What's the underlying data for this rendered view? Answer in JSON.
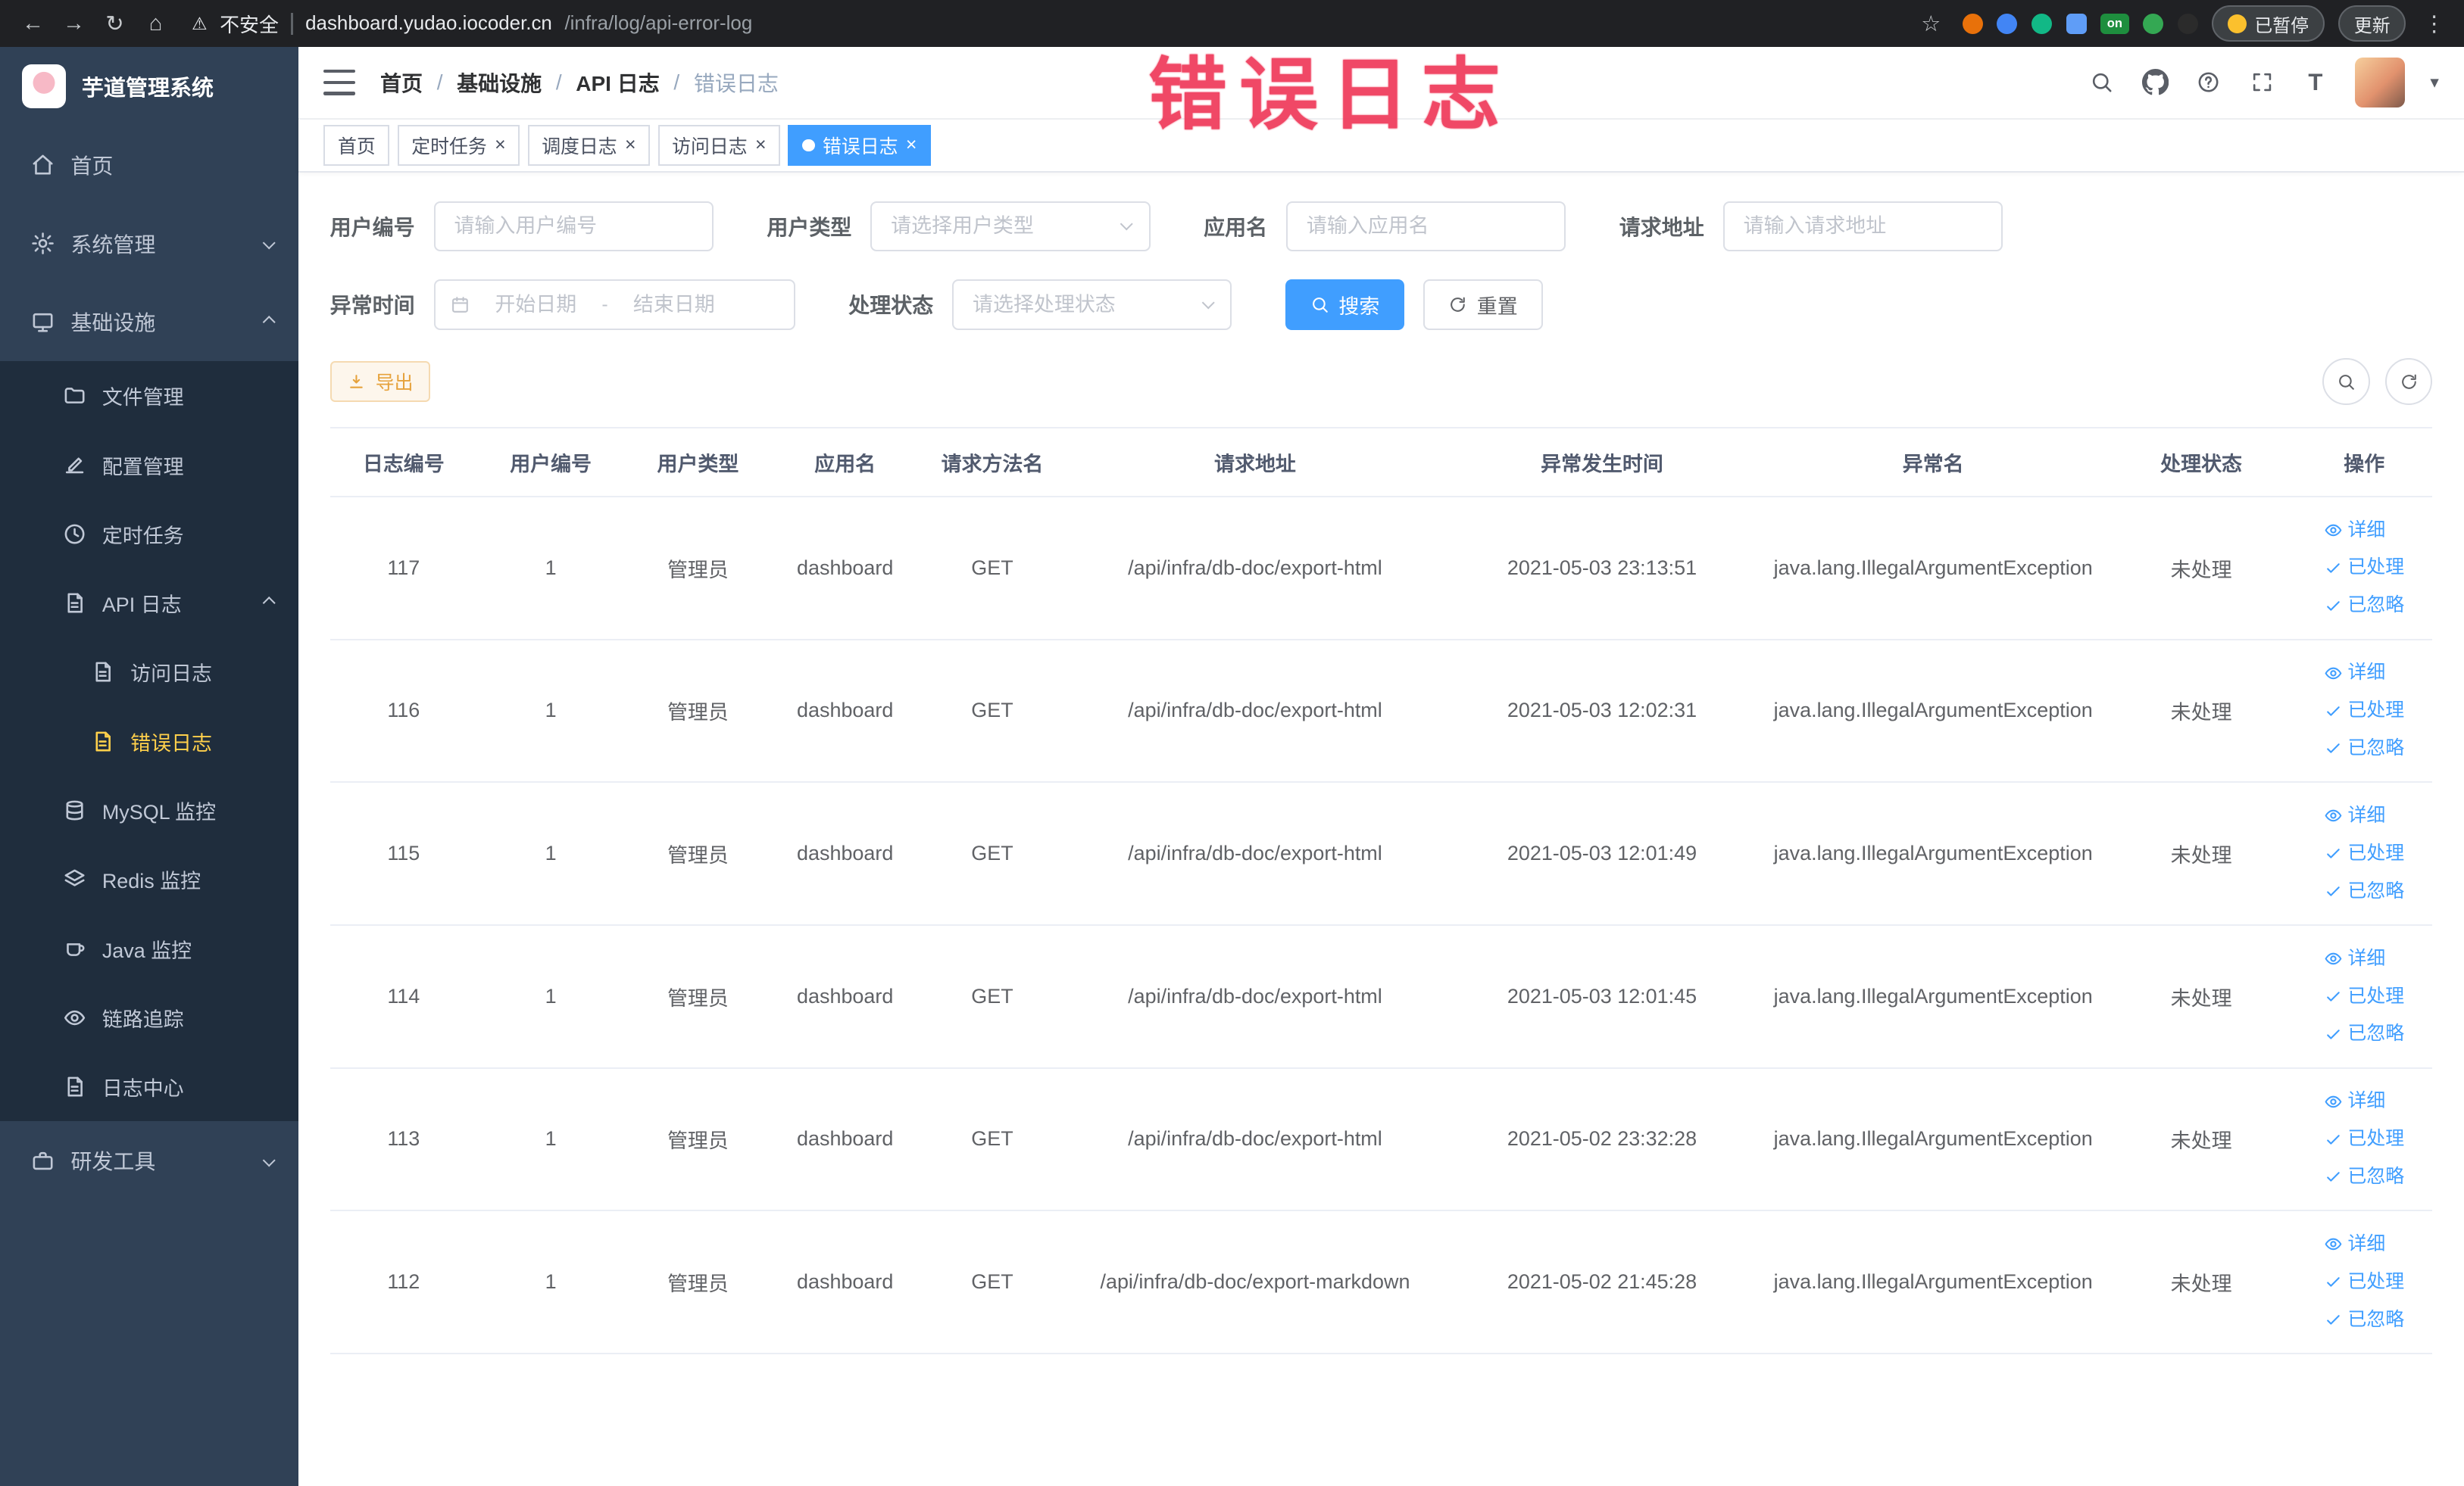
{
  "colors": {
    "accent": "#409eff",
    "sidebar_bg": "#304156",
    "submenu_bg": "#1f2d3d",
    "active_menu_text": "#ffd04b",
    "warning": "#e6a23c",
    "annotation_red": "#ef3b5b"
  },
  "icons": {
    "back": "←",
    "forward": "→",
    "reload": "↻",
    "home": "⌂",
    "warning": "⚠",
    "star": "☆",
    "kebab": "⋮",
    "close": "×",
    "caret": "▾",
    "font_size": "T"
  },
  "browser": {
    "security_label": "不安全",
    "url_domain": "dashboard.yudao.iocoder.cn",
    "url_path": "/infra/log/api-error-log",
    "ext_on_badge": "on",
    "paused_badge": "已暂停",
    "update_button": "更新"
  },
  "annotation": {
    "text": "错误日志"
  },
  "sidebar": {
    "logo_title": "芋道管理系统",
    "home": "首页",
    "system": "系统管理",
    "infra": "基础设施",
    "file": "文件管理",
    "config": "配置管理",
    "job": "定时任务",
    "api_log": "API 日志",
    "access_log": "访问日志",
    "error_log": "错误日志",
    "mysql": "MySQL 监控",
    "redis": "Redis 监控",
    "java": "Java 监控",
    "trace": "链路追踪",
    "log_center": "日志中心",
    "dev_tools": "研发工具"
  },
  "breadcrumb": {
    "separator": "/",
    "items": [
      "首页",
      "基础设施",
      "API 日志",
      "错误日志"
    ]
  },
  "tabs": {
    "items": [
      {
        "label": "首页"
      },
      {
        "label": "定时任务"
      },
      {
        "label": "调度日志"
      },
      {
        "label": "访问日志"
      },
      {
        "label": "错误日志"
      }
    ]
  },
  "filters": {
    "user_id_label": "用户编号",
    "user_id_placeholder": "请输入用户编号",
    "user_type_label": "用户类型",
    "user_type_placeholder": "请选择用户类型",
    "app_name_label": "应用名",
    "app_name_placeholder": "请输入应用名",
    "request_url_label": "请求地址",
    "request_url_placeholder": "请输入请求地址",
    "exception_time_label": "异常时间",
    "date_start_placeholder": "开始日期",
    "date_separator": "-",
    "date_end_placeholder": "结束日期",
    "process_status_label": "处理状态",
    "process_status_placeholder": "请选择处理状态",
    "search_button": "搜索",
    "reset_button": "重置"
  },
  "toolbar": {
    "export_button": "导出"
  },
  "table": {
    "columns": [
      "日志编号",
      "用户编号",
      "用户类型",
      "应用名",
      "请求方法名",
      "请求地址",
      "异常发生时间",
      "异常名",
      "处理状态",
      "操作"
    ],
    "actions": {
      "detail": "详细",
      "process": "已处理",
      "ignore": "已忽略"
    },
    "rows": [
      {
        "id": "117",
        "user_id": "1",
        "user_type": "管理员",
        "app": "dashboard",
        "method": "GET",
        "url": "/api/infra/db-doc/export-html",
        "time": "2021-05-03 23:13:51",
        "exception": "java.lang.IllegalArgumentException",
        "status": "未处理"
      },
      {
        "id": "116",
        "user_id": "1",
        "user_type": "管理员",
        "app": "dashboard",
        "method": "GET",
        "url": "/api/infra/db-doc/export-html",
        "time": "2021-05-03 12:02:31",
        "exception": "java.lang.IllegalArgumentException",
        "status": "未处理"
      },
      {
        "id": "115",
        "user_id": "1",
        "user_type": "管理员",
        "app": "dashboard",
        "method": "GET",
        "url": "/api/infra/db-doc/export-html",
        "time": "2021-05-03 12:01:49",
        "exception": "java.lang.IllegalArgumentException",
        "status": "未处理"
      },
      {
        "id": "114",
        "user_id": "1",
        "user_type": "管理员",
        "app": "dashboard",
        "method": "GET",
        "url": "/api/infra/db-doc/export-html",
        "time": "2021-05-03 12:01:45",
        "exception": "java.lang.IllegalArgumentException",
        "status": "未处理"
      },
      {
        "id": "113",
        "user_id": "1",
        "user_type": "管理员",
        "app": "dashboard",
        "method": "GET",
        "url": "/api/infra/db-doc/export-html",
        "time": "2021-05-02 23:32:28",
        "exception": "java.lang.IllegalArgumentException",
        "status": "未处理"
      },
      {
        "id": "112",
        "user_id": "1",
        "user_type": "管理员",
        "app": "dashboard",
        "method": "GET",
        "url": "/api/infra/db-doc/export-markdown",
        "time": "2021-05-02 21:45:28",
        "exception": "java.lang.IllegalArgumentException",
        "status": "未处理"
      }
    ]
  }
}
